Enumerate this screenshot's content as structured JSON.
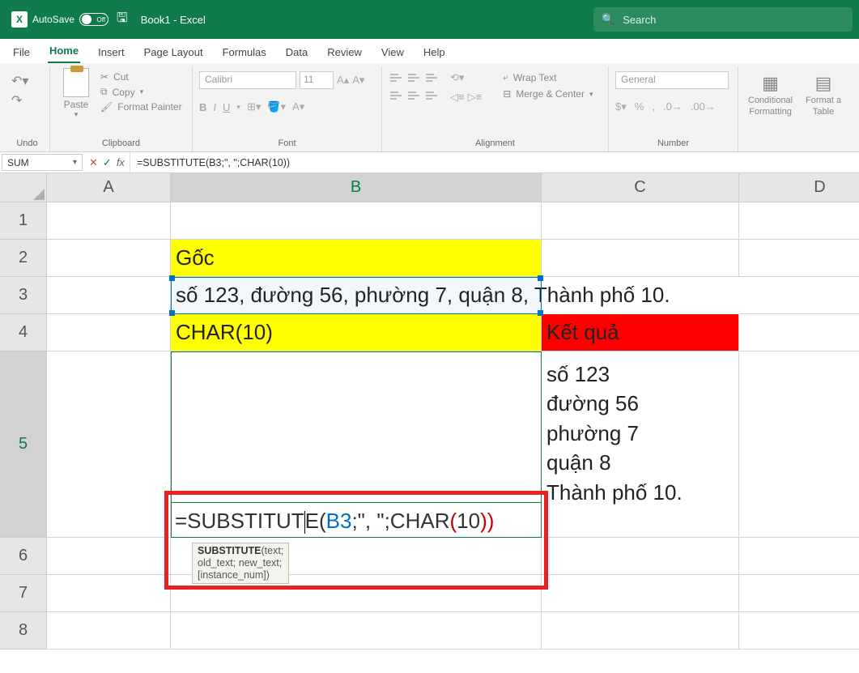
{
  "title": {
    "autosave": "AutoSave",
    "toggle_state": "Off",
    "doc": "Book1  -  Excel",
    "search_placeholder": "Search"
  },
  "tabs": {
    "file": "File",
    "home": "Home",
    "insert": "Insert",
    "page_layout": "Page Layout",
    "formulas": "Formulas",
    "data": "Data",
    "review": "Review",
    "view": "View",
    "help": "Help"
  },
  "ribbon": {
    "undo_label": "Undo",
    "paste": "Paste",
    "cut": "Cut",
    "copy": "Copy",
    "format_painter": "Format Painter",
    "clipboard_label": "Clipboard",
    "font_name": "Calibri",
    "font_size": "11",
    "font_label": "Font",
    "b": "B",
    "i": "I",
    "u": "U",
    "wrap": "Wrap Text",
    "merge": "Merge & Center",
    "alignment_label": "Alignment",
    "number_format": "General",
    "number_label": "Number",
    "cond_fmt": "Conditional",
    "cond_fmt2": "Formatting",
    "fmt_table": "Format a",
    "fmt_table2": "Table"
  },
  "formulabar": {
    "namebox": "SUM",
    "formula": "=SUBSTITUTE(B3;\", \";CHAR(10))"
  },
  "columns": {
    "A": "A",
    "B": "B",
    "C": "C",
    "D": "D"
  },
  "rows": {
    "r1": "1",
    "r2": "2",
    "r3": "3",
    "r4": "4",
    "r5": "5",
    "r6": "6",
    "r7": "7",
    "r8": "8"
  },
  "cells": {
    "B2": "Gốc",
    "B3": "số 123, đường 56, phường 7, quận 8, Thành phố 10.",
    "B4": "CHAR(10)",
    "C4": "Kết quả",
    "C5": "số 123\nđường 56\nphường 7\nquận 8\nThành phố 10.",
    "B5_prefix": "=SUBSTITUT",
    "B5_e_open": "E(",
    "B5_ref": "B3",
    "B5_mid": ";\", \";CHAR",
    "B5_po": "(",
    "B5_ten": "10",
    "B5_pc": "))"
  },
  "tooltip": {
    "fn": "SUBSTITUTE",
    "sig": "(text; old_text; new_text; [instance_num])"
  },
  "col_widths": {
    "A": 153,
    "B": 458,
    "C": 244,
    "D": 200
  },
  "row_heights": {
    "h": 46,
    "r5": 230
  }
}
